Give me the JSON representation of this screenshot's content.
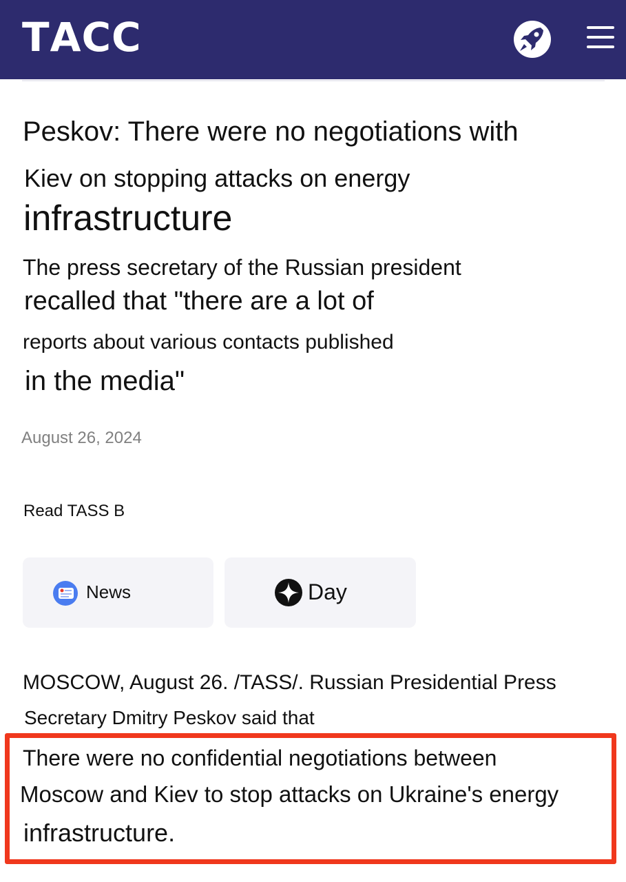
{
  "header": {
    "logo": "ТАСС",
    "rocket_icon": "rocket-icon",
    "menu_icon": "hamburger-menu-icon",
    "background_color": "#2d2b6e"
  },
  "article": {
    "title_lines": [
      "Peskov: There were no negotiations with",
      "Kiev on stopping attacks on energy",
      "infrastructure"
    ],
    "lead_lines": [
      "The press secretary of the Russian president",
      "recalled that \"there are a lot of",
      "reports about various contacts published",
      "in the media\""
    ],
    "date": "August 26, 2024",
    "read_label": "Read TASS B",
    "services": [
      {
        "label": "News",
        "icon": "news-service-icon"
      },
      {
        "label": "Day",
        "icon": "day-service-icon"
      }
    ],
    "body_lines": [
      "MOSCOW, August 26. /TASS/. Russian Presidential Press",
      "Secretary Dmitry Peskov said that"
    ],
    "highlight_lines": [
      "There were no confidential negotiations between",
      "Moscow and Kiev to stop attacks on Ukraine's energy",
      "infrastructure."
    ],
    "highlight_color": "#f0381d"
  }
}
